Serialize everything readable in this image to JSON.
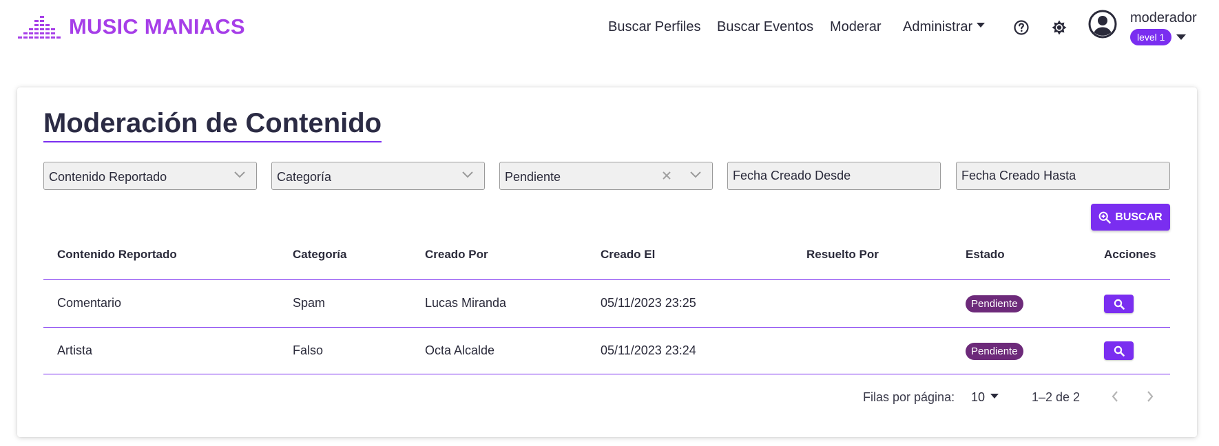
{
  "brand": {
    "name": "MUSIC MANIACS",
    "color": "#a63ee8",
    "icon": "equalizer-logo-icon"
  },
  "nav": {
    "links": [
      "Buscar Perfiles",
      "Buscar Eventos",
      "Moderar"
    ],
    "admin_label": "Administrar",
    "help_icon": "help-circle-icon",
    "theme_icon": "sun-brightness-icon"
  },
  "user": {
    "name": "moderador",
    "level": "level 1",
    "avatar_icon": "account-circle-icon"
  },
  "page": {
    "title": "Moderación de Contenido",
    "accent": "#7a2ef0"
  },
  "filters": {
    "reported_content": "Contenido Reportado",
    "category": "Categoría",
    "status": "Pendiente",
    "date_from": "Fecha Creado Desde",
    "date_to": "Fecha Creado Hasta"
  },
  "search_button": {
    "label": "BUSCAR",
    "icon": "zoom-in-icon"
  },
  "table": {
    "columns": [
      "Contenido Reportado",
      "Categoría",
      "Creado Por",
      "Creado El",
      "Resuelto Por",
      "Estado",
      "Acciones"
    ],
    "rows": [
      {
        "content": "Comentario",
        "category": "Spam",
        "created_by": "Lucas Miranda",
        "created_at": "05/11/2023 23:25",
        "resolved_by": "",
        "status": "Pendiente"
      },
      {
        "content": "Artista",
        "category": "Falso",
        "created_by": "Octa Alcalde",
        "created_at": "05/11/2023 23:24",
        "resolved_by": "",
        "status": "Pendiente"
      }
    ],
    "status_color": "#6d2a7a"
  },
  "pagination": {
    "rows_per_page_label": "Filas por página:",
    "rows_per_page": "10",
    "range": "1–2 de 2"
  }
}
